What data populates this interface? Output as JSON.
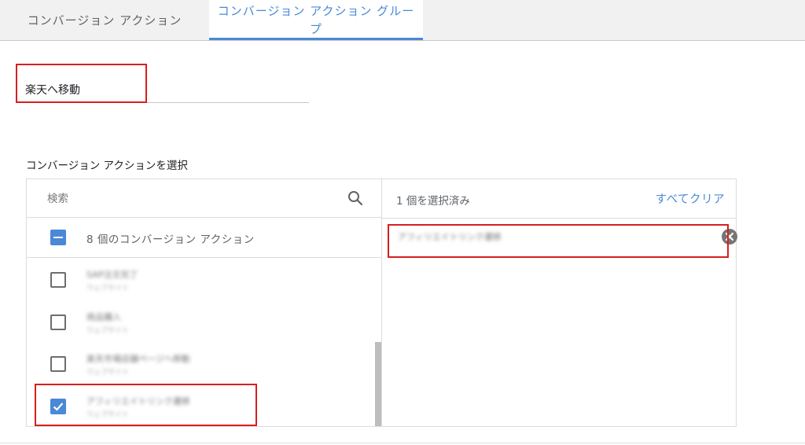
{
  "tabs": [
    {
      "label": "コンバージョン アクション"
    },
    {
      "label": "コンバージョン アクション グループ"
    }
  ],
  "group_name": "楽天へ移動",
  "section_label": "コンバージョン アクションを選択",
  "search": {
    "placeholder": "検索"
  },
  "select_all_label": "8 個のコンバージョン アクション",
  "list_items": [
    {
      "title": "SAP注文完了",
      "subtitle": "ウェブサイト",
      "checked": false
    },
    {
      "title": "商品購入",
      "subtitle": "ウェブサイト",
      "checked": false
    },
    {
      "title": "楽天市場店舗ページへ移動",
      "subtitle": "ウェブサイト",
      "checked": false
    },
    {
      "title": "アフィリエイトリンク遷移",
      "subtitle": "ウェブサイト",
      "checked": true
    }
  ],
  "selection": {
    "count_label": "1 個を選択済み",
    "clear_all_label": "すべてクリア",
    "selected_items": [
      "アフィリエイトリンク遷移"
    ]
  },
  "colors": {
    "accent": "#4a88d8",
    "highlight": "#d81e1e"
  }
}
